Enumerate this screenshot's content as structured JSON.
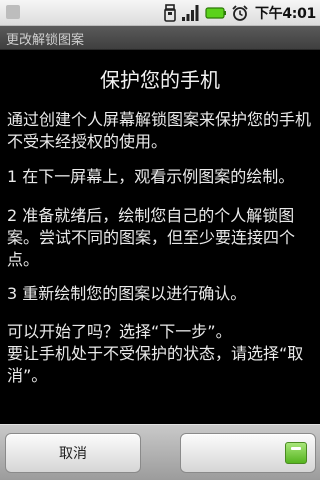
{
  "status_bar": {
    "time": "下午4:01",
    "icons": [
      "unknown-notification-icon",
      "sd-card-icon",
      "signal-strength-icon",
      "battery-icon",
      "alarm-clock-icon"
    ],
    "battery_color": "#5bd21b"
  },
  "header": {
    "title": "更改解锁图案"
  },
  "main": {
    "heading": "保护您的手机",
    "intro": "通过创建个人屏幕解锁图案来保护您的手机不受未经授权的使用。",
    "step1": "1 在下一屏幕上，观看示例图案的绘制。",
    "step2": "2 准备就绪后，绘制您自己的个人解锁图案。尝试不同的图案，但至少要连接四个点。",
    "step3": "3 重新绘制您的图案以进行确认。",
    "ready": "可以开始了吗？选择“下一步”。",
    "cancel_hint": "要让手机处于不受保护的状态，请选择“取消”。"
  },
  "buttons": {
    "cancel_label": "取消"
  }
}
